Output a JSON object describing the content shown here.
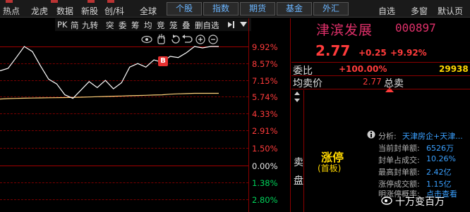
{
  "toolbar": {
    "items": [
      "热点",
      "龙虎",
      "数据",
      "新股",
      "创/科",
      "全球"
    ],
    "buttons": [
      "个股",
      "指数",
      "期货",
      "基金",
      "外汇"
    ],
    "right": [
      "自选",
      "多窗",
      "默认页"
    ]
  },
  "chart_toolbar": [
    "PK",
    "简",
    "九转",
    "突",
    "委",
    "筹",
    "均",
    "竞",
    "笼",
    "叠",
    "删自选"
  ],
  "stock": {
    "name": "津滨发展",
    "code": "000897",
    "price": "2.77",
    "change": "+0.25",
    "change_pct": "+9.92%"
  },
  "axis_pcts": [
    {
      "label": "9.92%",
      "color": "red"
    },
    {
      "label": "8.57%",
      "color": "red"
    },
    {
      "label": "7.15%",
      "color": "red"
    },
    {
      "label": "5.74%",
      "color": "red"
    },
    {
      "label": "4.33%",
      "color": "red"
    },
    {
      "label": "2.91%",
      "color": "red"
    },
    {
      "label": "1.50%",
      "color": "red"
    },
    {
      "label": "0.00%",
      "color": "white"
    },
    {
      "label": "1.38%",
      "color": "green"
    },
    {
      "label": "2.80%",
      "color": "green"
    }
  ],
  "badge": "B",
  "panel": {
    "weibi_label": "委比",
    "weibi_value": "+100.00%",
    "weibi_right": "29938",
    "junmai_label": "均卖价",
    "junmai_value": "2.77",
    "zongmai_label": "总卖",
    "sell_label": "卖盘",
    "limit_up": "涨停",
    "limit_sub": "(首板)",
    "analysis_label": "分析:",
    "analysis_value": "天津房企+天津...",
    "info": [
      {
        "label": "当前封单额:",
        "value": "6526万"
      },
      {
        "label": "封单占成交:",
        "value": "10.26%"
      },
      {
        "label": "最高封单额:",
        "value": "2.42亿"
      },
      {
        "label": "涨停成交额:",
        "value": "1.15亿"
      },
      {
        "label": "明涨停概率:",
        "value": "点击查看"
      }
    ],
    "watermark": "十万变百万"
  },
  "colors": {
    "up": "#ff3b3b",
    "down": "#00d25a",
    "price_line": "#ffffff",
    "avg_line": "#ffd27a",
    "accent": "#e0306a"
  },
  "chart_data": {
    "type": "line",
    "series": [
      {
        "values": [
          7.9,
          8.1,
          9.0,
          9.92,
          9.5,
          8.3,
          7.2,
          6.8,
          5.9,
          5.6,
          6.3,
          7.0,
          6.5,
          7.1,
          6.4,
          6.9,
          8.2,
          8.5,
          8.2,
          8.8,
          8.6,
          9.1,
          9.0,
          9.4,
          9.92,
          9.8,
          9.92,
          9.92
        ]
      },
      {
        "values": [
          5.55,
          5.58,
          5.6,
          5.62,
          5.63,
          5.64,
          5.65,
          5.66,
          5.67,
          5.68,
          5.7,
          5.72,
          5.74,
          5.76,
          5.78,
          5.8,
          5.82,
          5.84,
          5.86,
          5.88,
          5.9,
          5.95,
          5.98,
          6.0,
          6.02,
          6.02,
          6.02,
          6.02
        ]
      }
    ],
    "ylim": [
      -2.8,
      9.92
    ]
  }
}
